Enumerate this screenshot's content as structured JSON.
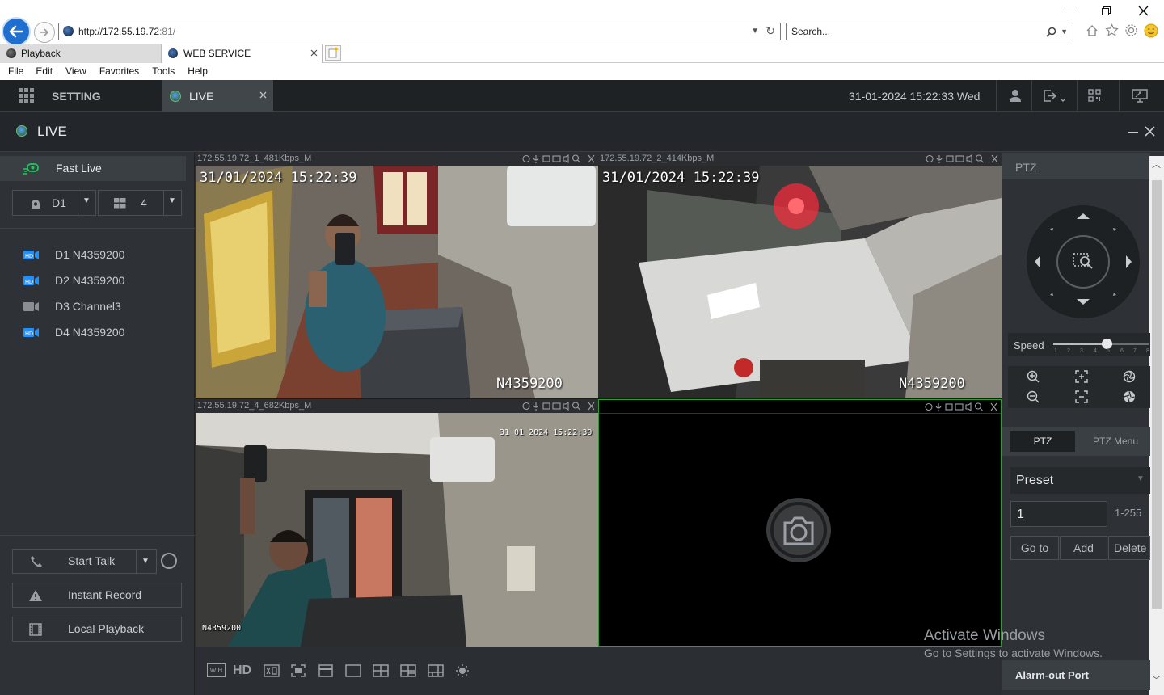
{
  "browser": {
    "address": "http://172.55.19.72:81/",
    "address_host": "http://172.55.19.72",
    "address_port": ":81/",
    "search_placeholder": "Search...",
    "tabs": [
      {
        "label": "Playback"
      },
      {
        "label": "WEB SERVICE"
      }
    ],
    "menu": [
      "File",
      "Edit",
      "View",
      "Favorites",
      "Tools",
      "Help"
    ]
  },
  "app": {
    "setting_label": "SETTING",
    "live_tab_label": "LIVE",
    "datetime": "31-01-2024 15:22:33 Wed",
    "page_title": "LIVE"
  },
  "left": {
    "fast_live_label": "Fast Live",
    "device_select": "D1",
    "split_select": "4",
    "channels": [
      {
        "label": "D1 N4359200",
        "color": "#1e90ff"
      },
      {
        "label": "D2 N4359200",
        "color": "#1e90ff"
      },
      {
        "label": "D3 Channel3",
        "color": "#8a8e92"
      },
      {
        "label": "D4 N4359200",
        "color": "#1e90ff"
      }
    ],
    "start_talk_label": "Start Talk",
    "instant_record_label": "Instant Record",
    "local_playback_label": "Local Playback"
  },
  "video": {
    "panes": [
      {
        "title": "172.55.19.72_1_481Kbps_M",
        "timestamp": "31/01/2024 15:22:39",
        "camera_name": "N4359200",
        "scene": "atm-room-selfie"
      },
      {
        "title": "172.55.19.72_2_414Kbps_M",
        "timestamp": "31/01/2024 15:22:39",
        "camera_name": "N4359200",
        "scene": "atm-backroom"
      },
      {
        "title": "172.55.19.72_4_682Kbps_M",
        "timestamp": "31 01 2024 15:22:39",
        "camera_name": "N4359200",
        "scene": "atm-room-phone"
      },
      {
        "title": "",
        "timestamp": "",
        "camera_name": "",
        "scene": "no-video"
      }
    ],
    "selected_pane_color": "#2ca02c"
  },
  "toolbar": {
    "wh_label": "W:H",
    "hd_label": "HD"
  },
  "ptz": {
    "header": "PTZ",
    "speed_label": "Speed",
    "speed_ticks": [
      "1",
      "2",
      "3",
      "4",
      "5",
      "6",
      "7",
      "8"
    ],
    "speed_value": 5,
    "tab_ptz": "PTZ",
    "tab_ptz_menu": "PTZ Menu",
    "preset_select": "Preset",
    "preset_value": "1",
    "preset_range": "1-255",
    "goto_label": "Go to",
    "add_label": "Add",
    "delete_label": "Delete",
    "alarm_out_label": "Alarm-out Port"
  },
  "watermark": {
    "title": "Activate Windows",
    "subtitle": "Go to Settings to activate Windows."
  },
  "colors": {
    "accent_green": "#2ca02c",
    "accent_blue": "#1e90ff",
    "fast_live_green": "#22c55e",
    "browser_back": "#1e6fd0"
  }
}
